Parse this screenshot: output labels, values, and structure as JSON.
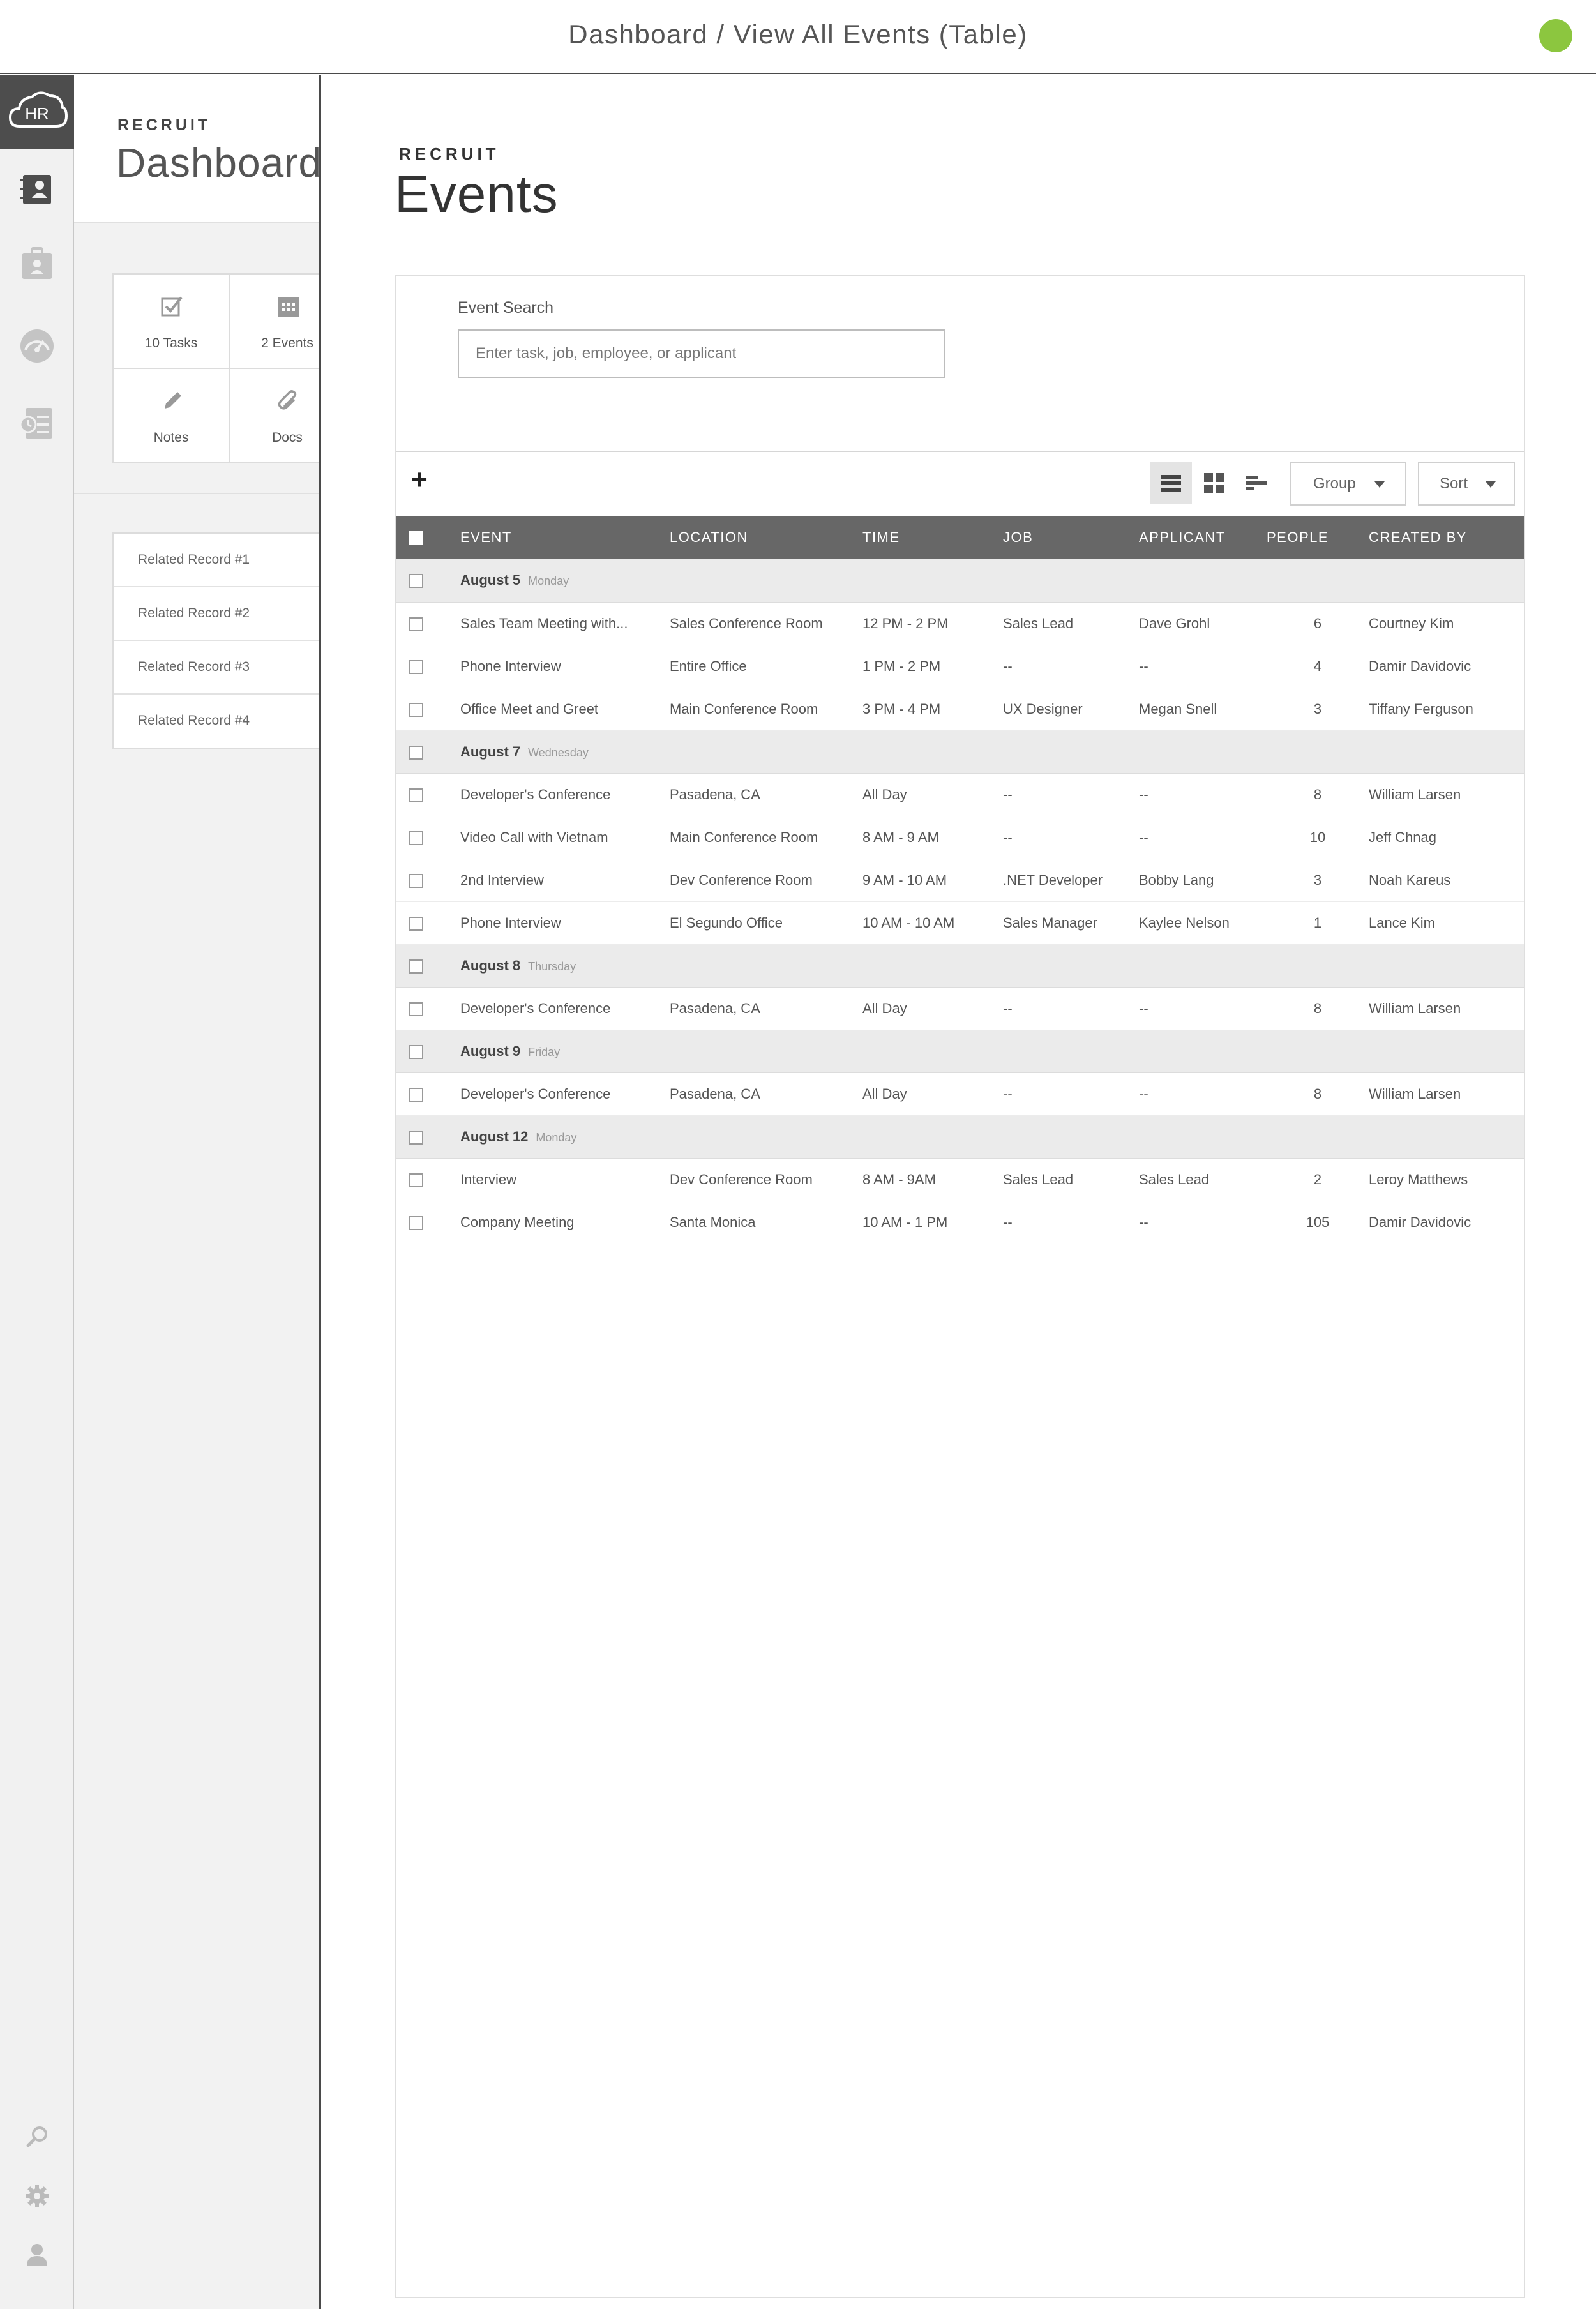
{
  "header": {
    "title": "Dashboard / View All Events (Table)",
    "status_color": "#8cc63f"
  },
  "rail": {
    "logo": "HR",
    "icons": [
      "hr-cloud-logo",
      "contacts-icon",
      "badge-icon",
      "speedometer-icon",
      "timesheet-icon"
    ],
    "bottom_icons": [
      "search-icon",
      "gear-icon",
      "user-icon"
    ]
  },
  "dashboard": {
    "eyebrow": "RECRUIT",
    "title": "Dashboard",
    "tiles": [
      {
        "label": "10 Tasks",
        "icon": "check-icon"
      },
      {
        "label": "2 Events",
        "icon": "calendar-icon"
      },
      {
        "label": "Notes",
        "icon": "pencil-icon"
      },
      {
        "label": "Docs",
        "icon": "paperclip-icon"
      }
    ],
    "related": [
      "Related Record #1",
      "Related Record #2",
      "Related Record #3",
      "Related Record #4"
    ]
  },
  "events_page": {
    "eyebrow": "RECRUIT",
    "title": "Events",
    "search": {
      "label": "Event Search",
      "placeholder": "Enter task, job, employee, or applicant"
    },
    "toolbar": {
      "add": "+",
      "group_label": "Group",
      "sort_label": "Sort",
      "views": [
        "list-view-icon",
        "grid-view-icon",
        "timeline-view-icon"
      ]
    },
    "columns": [
      "EVENT",
      "LOCATION",
      "TIME",
      "JOB",
      "APPLICANT",
      "PEOPLE",
      "CREATED BY"
    ],
    "groups": [
      {
        "date": "August 5",
        "day": "Monday",
        "rows": [
          [
            "Sales Team Meeting with...",
            "Sales Conference Room",
            "12 PM - 2 PM",
            "Sales Lead",
            "Dave Grohl",
            "6",
            "Courtney Kim"
          ],
          [
            "Phone Interview",
            "Entire Office",
            "1 PM - 2 PM",
            "--",
            "--",
            "4",
            "Damir Davidovic"
          ],
          [
            "Office Meet and Greet",
            "Main Conference Room",
            "3 PM - 4 PM",
            "UX Designer",
            "Megan Snell",
            "3",
            "Tiffany Ferguson"
          ]
        ]
      },
      {
        "date": "August 7",
        "day": "Wednesday",
        "rows": [
          [
            "Developer's Conference",
            "Pasadena, CA",
            "All Day",
            "--",
            "--",
            "8",
            "William Larsen"
          ],
          [
            "Video Call with Vietnam",
            "Main Conference Room",
            "8 AM - 9 AM",
            "--",
            "--",
            "10",
            "Jeff Chnag"
          ],
          [
            "2nd Interview",
            "Dev Conference Room",
            "9 AM - 10 AM",
            ".NET Developer",
            "Bobby Lang",
            "3",
            "Noah Kareus"
          ],
          [
            "Phone Interview",
            "El Segundo Office",
            "10 AM - 10 AM",
            "Sales Manager",
            "Kaylee Nelson",
            "1",
            "Lance Kim"
          ]
        ]
      },
      {
        "date": "August 8",
        "day": "Thursday",
        "rows": [
          [
            "Developer's Conference",
            "Pasadena, CA",
            "All Day",
            "--",
            "--",
            "8",
            "William Larsen"
          ]
        ]
      },
      {
        "date": "August 9",
        "day": "Friday",
        "rows": [
          [
            "Developer's Conference",
            "Pasadena, CA",
            "All Day",
            "--",
            "--",
            "8",
            "William Larsen"
          ]
        ]
      },
      {
        "date": "August 12",
        "day": "Monday",
        "rows": [
          [
            "Interview",
            "Dev Conference Room",
            "8 AM - 9AM",
            "Sales Lead",
            "Sales Lead",
            "2",
            "Leroy Matthews"
          ],
          [
            "Company Meeting",
            "Santa Monica",
            "10 AM - 1 PM",
            "--",
            "--",
            "105",
            "Damir Davidovic"
          ]
        ]
      }
    ]
  }
}
